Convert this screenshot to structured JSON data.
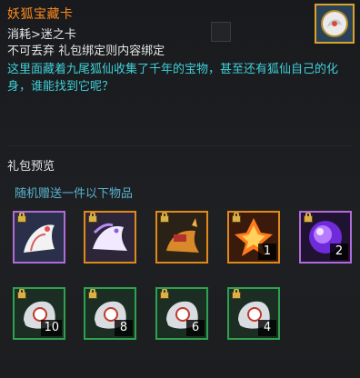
{
  "item": {
    "title": "妖狐宝藏卡",
    "consume_line": "消耗>迷之卡",
    "bind_line": "不可丢弃 礼包绑定则内容绑定",
    "description": "这里面藏着九尾狐仙收集了千年的宝物，甚至还有狐仙自己的化身，谁能找到它呢？",
    "icon": "fox-card-icon"
  },
  "colors": {
    "title": "#ff8a1e",
    "description": "#3fd0d8",
    "subtitle": "#5ab2ce",
    "border_purple": "#b16bd8",
    "border_orange": "#e18a1b",
    "border_green": "#2da24e"
  },
  "preview": {
    "heading": "礼包预览",
    "subheading": "随机赠送一件以下物品",
    "row1": [
      {
        "icon": "white-nine-tail-fox-icon",
        "border": "purple",
        "count": ""
      },
      {
        "icon": "spirit-fox-mount-icon",
        "border": "orange",
        "count": ""
      },
      {
        "icon": "golden-fox-mount-icon",
        "border": "orange",
        "count": ""
      },
      {
        "icon": "fire-crystal-icon",
        "border": "orange",
        "count": "1"
      },
      {
        "icon": "purple-crystal-icon",
        "border": "purple",
        "count": "2"
      }
    ],
    "row2": [
      {
        "icon": "material-pouch-icon",
        "border": "green",
        "count": "10"
      },
      {
        "icon": "material-pouch-icon",
        "border": "green",
        "count": "8"
      },
      {
        "icon": "material-pouch-icon",
        "border": "green",
        "count": "6"
      },
      {
        "icon": "material-pouch-icon",
        "border": "green",
        "count": "4"
      }
    ]
  }
}
